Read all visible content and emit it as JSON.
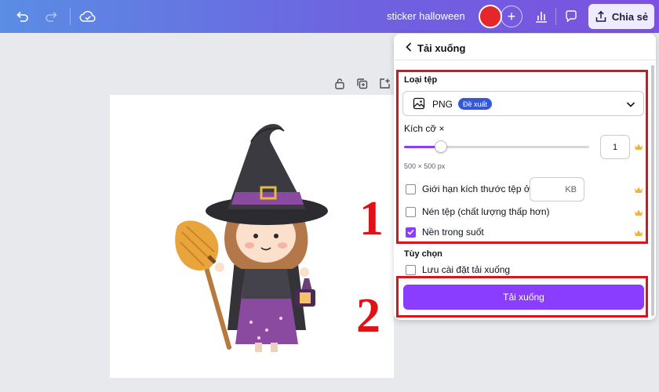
{
  "topbar": {
    "undo_icon": "undo-icon",
    "redo_icon": "redo-icon",
    "cloud_icon": "cloud-check-icon",
    "doc_title": "sticker halloween",
    "plus_label": "+",
    "share_label": "Chia sẻ"
  },
  "download_panel": {
    "title": "Tải xuống",
    "file_type": {
      "label": "Loại tệp",
      "selected": "PNG",
      "badge": "Đề xuất"
    },
    "size": {
      "label": "Kích cỡ ×",
      "value": "1",
      "dimensions": "500 × 500 px",
      "slider_fraction": 0.2
    },
    "options": [
      {
        "label": "Giới hạn kích thước tệp ở",
        "checked": false
      },
      {
        "label": "Nén tệp (chất lượng thấp hơn)",
        "checked": false
      },
      {
        "label": "Nền trong suốt",
        "checked": true
      }
    ],
    "kb_unit": "KB",
    "more_options": {
      "label": "Tùy chọn",
      "save_settings": "Lưu cài đặt tải xuống"
    },
    "download_button": "Tải xuống"
  },
  "annotations": {
    "step1": "1",
    "step2": "2"
  },
  "colors": {
    "accent": "#8b3dff",
    "badge": "#3657d8",
    "annotation": "#e01216",
    "avatar": "#e5262b"
  }
}
